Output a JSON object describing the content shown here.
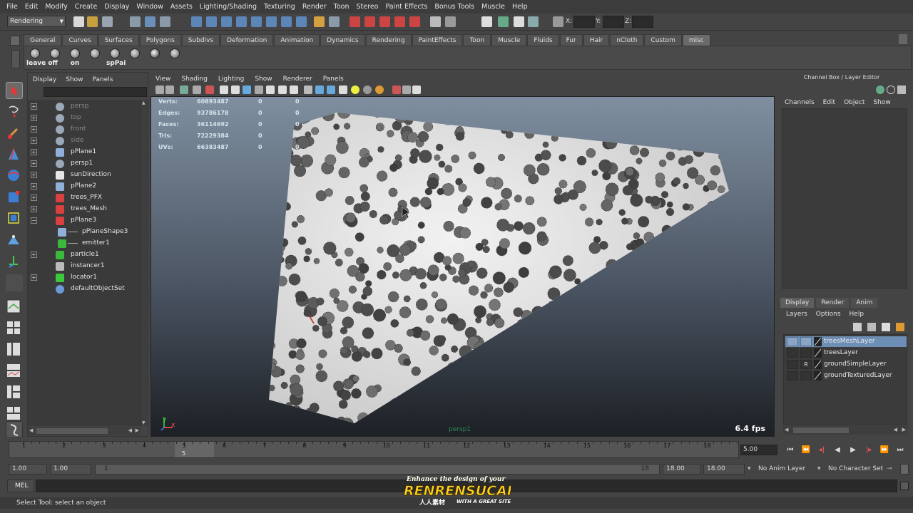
{
  "menubar": [
    "File",
    "Edit",
    "Modify",
    "Create",
    "Display",
    "Window",
    "Assets",
    "Lighting/Shading",
    "Texturing",
    "Render",
    "Toon",
    "Stereo",
    "Paint Effects",
    "Bonus Tools",
    "Muscle",
    "Help"
  ],
  "statusline": {
    "mode": "Rendering",
    "x_label": "X:",
    "y_label": "Y:",
    "z_label": "Z:"
  },
  "shelf_tabs": [
    "General",
    "Curves",
    "Surfaces",
    "Polygons",
    "Subdivs",
    "Deformation",
    "Animation",
    "Dynamics",
    "Rendering",
    "PaintEffects",
    "Toon",
    "Muscle",
    "Fluids",
    "Fur",
    "Hair",
    "nCloth",
    "Custom",
    "misc"
  ],
  "shelf_active": "misc",
  "shelf_buttons": [
    {
      "label": "leave off",
      "icon": "brush-icon"
    },
    {
      "label": "",
      "icon": "brush-icon"
    },
    {
      "label": "on",
      "icon": "brush-icon"
    },
    {
      "label": "",
      "icon": "brush-icon"
    },
    {
      "label": "spPai",
      "icon": "brush-icon"
    },
    {
      "label": "",
      "icon": "brush-icon"
    },
    {
      "label": "",
      "icon": "refresh-icon"
    },
    {
      "label": "",
      "icon": "brush-icon"
    }
  ],
  "outliner": {
    "menu": [
      "Display",
      "Show",
      "Panels"
    ],
    "items": [
      {
        "label": "persp",
        "icon": "camera-icon",
        "dim": true,
        "expand": "+"
      },
      {
        "label": "top",
        "icon": "camera-icon",
        "dim": true,
        "expand": "+"
      },
      {
        "label": "front",
        "icon": "camera-icon",
        "dim": true,
        "expand": "+"
      },
      {
        "label": "side",
        "icon": "camera-icon",
        "dim": true,
        "expand": "+"
      },
      {
        "label": "pPlane1",
        "icon": "mesh-icon",
        "dim": false,
        "expand": "+"
      },
      {
        "label": "persp1",
        "icon": "camera-icon",
        "dim": false,
        "expand": "+"
      },
      {
        "label": "sunDirection",
        "icon": "light-icon",
        "dim": false,
        "expand": "+"
      },
      {
        "label": "pPlane2",
        "icon": "mesh-icon",
        "dim": false,
        "expand": "+"
      },
      {
        "label": "trees_PFX",
        "icon": "paintfx-icon",
        "dim": false,
        "expand": "+"
      },
      {
        "label": "trees_Mesh",
        "icon": "paintfx-icon",
        "dim": false,
        "expand": "+"
      },
      {
        "label": "pPlane3",
        "icon": "paintfx-icon",
        "dim": false,
        "expand": "−"
      },
      {
        "label": "pPlaneShape3",
        "icon": "mesh-icon",
        "dim": false,
        "expand": "",
        "child": true
      },
      {
        "label": "emitter1",
        "icon": "emitter-icon",
        "dim": false,
        "expand": "",
        "child": true
      },
      {
        "label": "particle1",
        "icon": "particle-icon",
        "dim": false,
        "expand": "+"
      },
      {
        "label": "instancer1",
        "icon": "instancer-icon",
        "dim": false,
        "expand": ""
      },
      {
        "label": "locator1",
        "icon": "locator-icon",
        "dim": false,
        "expand": "+"
      },
      {
        "label": "defaultObjectSet",
        "icon": "set-icon",
        "dim": false,
        "expand": ""
      }
    ]
  },
  "viewport": {
    "menu": [
      "View",
      "Shading",
      "Lighting",
      "Show",
      "Renderer",
      "Panels"
    ],
    "hud": [
      {
        "label": "Verts:",
        "v1": "60893487",
        "v2": "0",
        "v3": "0"
      },
      {
        "label": "Edges:",
        "v1": "93786178",
        "v2": "0",
        "v3": "0"
      },
      {
        "label": "Faces:",
        "v1": "36114692",
        "v2": "0",
        "v3": "0"
      },
      {
        "label": "Tris:",
        "v1": "72229384",
        "v2": "0",
        "v3": "0"
      },
      {
        "label": "UVs:",
        "v1": "66383487",
        "v2": "0",
        "v3": "0"
      }
    ],
    "fps": "6.4 fps",
    "camera": "persp1",
    "axis_y": "y",
    "axis_x": "x"
  },
  "channel_box": {
    "title": "Channel Box / Layer Editor",
    "menu": [
      "Channels",
      "Edit",
      "Object",
      "Show"
    ]
  },
  "layer_editor": {
    "tabs": [
      "Display",
      "Render",
      "Anim"
    ],
    "active_tab": "Display",
    "menu": [
      "Layers",
      "Options",
      "Help"
    ],
    "layers": [
      {
        "name": "treesMeshLayer",
        "p": "",
        "selected": true
      },
      {
        "name": "treesLayer",
        "p": "",
        "selected": false
      },
      {
        "name": "groundSimpleLayer",
        "p": "R",
        "selected": false
      },
      {
        "name": "groundTexturedLayer",
        "p": "",
        "selected": false
      }
    ]
  },
  "timeline": {
    "ticks": [
      "1",
      "2",
      "3",
      "4",
      "5",
      "6",
      "7",
      "8",
      "9",
      "10",
      "11",
      "12",
      "13",
      "14",
      "15",
      "16",
      "17",
      "18"
    ],
    "current_frame": "5",
    "current_time": "5.00"
  },
  "range": {
    "start": "1.00",
    "anim_start": "1.00",
    "range_start": "1",
    "range_end": "18",
    "anim_end": "18.00",
    "end": "18.00",
    "anim_layer": "No Anim Layer",
    "char_set": "No Character Set"
  },
  "command_line": {
    "label": "MEL"
  },
  "help_line": "Select Tool: select an object",
  "watermark": {
    "tagline": "Enhance the design of your",
    "brand": "RENRENSUCAI.COM",
    "sub": "WITH A GREAT SITE !",
    "cn": "人人素材"
  },
  "colors": {
    "accent_select": "#6e8fb5",
    "hud_text": "#d6e4ec",
    "camera_label": "#2e8b57"
  }
}
